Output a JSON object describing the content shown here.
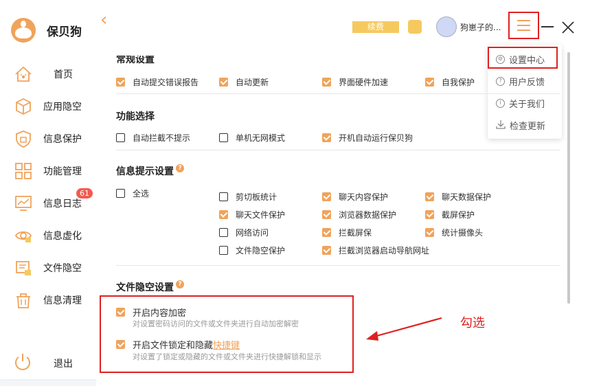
{
  "app": {
    "name": "保贝狗"
  },
  "sidebar": {
    "items": [
      {
        "label": "首页",
        "icon": "home-paw-icon"
      },
      {
        "label": "应用隐空",
        "icon": "cube-icon"
      },
      {
        "label": "信息保护",
        "icon": "shield-bag-icon"
      },
      {
        "label": "功能管理",
        "icon": "grid-icon"
      },
      {
        "label": "信息日志",
        "icon": "chart-monitor-icon",
        "badge": "61"
      },
      {
        "label": "信息虚化",
        "icon": "eye-lock-icon"
      },
      {
        "label": "文件隐空",
        "icon": "folder-lock-icon"
      },
      {
        "label": "信息清理",
        "icon": "trash-icon"
      }
    ],
    "logout": "退出"
  },
  "header": {
    "renew": "续费",
    "username": "狗崽子的...",
    "menu": [
      "设置中心",
      "用户反馈",
      "关于我们",
      "检查更新"
    ]
  },
  "settings": {
    "general": {
      "title": "常规设置",
      "options": [
        {
          "label": "自动提交错误报告",
          "checked": true
        },
        {
          "label": "自动更新",
          "checked": true
        },
        {
          "label": "界面硬件加速",
          "checked": true
        },
        {
          "label": "自我保护",
          "checked": true
        }
      ]
    },
    "features": {
      "title": "功能选择",
      "options": [
        {
          "label": "自动拦截不提示",
          "checked": false
        },
        {
          "label": "单机无网模式",
          "checked": false
        },
        {
          "label": "开机自动运行保贝狗",
          "checked": true
        }
      ]
    },
    "notify": {
      "title": "信息提示设置",
      "select_all": "全选",
      "options": [
        {
          "label": "剪切板统计",
          "checked": false
        },
        {
          "label": "聊天内容保护",
          "checked": true
        },
        {
          "label": "聊天数据保护",
          "checked": true
        },
        {
          "label": "聊天文件保护",
          "checked": true
        },
        {
          "label": "浏览器数据保护",
          "checked": true
        },
        {
          "label": "截屏保护",
          "checked": true
        },
        {
          "label": "网络访问",
          "checked": false
        },
        {
          "label": "拦截屏保",
          "checked": true
        },
        {
          "label": "统计摄像头",
          "checked": true
        },
        {
          "label": "文件隐空保护",
          "checked": false
        },
        {
          "label": "拦截浏览器启动导航网址",
          "checked": true
        }
      ]
    },
    "file_space": {
      "title": "文件隐空设置",
      "encrypt_label": "开启内容加密",
      "encrypt_desc": "对设置密码访问的文件或文件夹进行自动加密解密",
      "lock_label": "开启文件锁定和隐藏",
      "lock_link": "快捷键",
      "lock_desc": "对设置了锁定或隐藏的文件或文件夹进行快捷解锁和显示"
    }
  },
  "annotation": "勾选",
  "colors": {
    "accent": "#f0a35b",
    "highlight": "#e02020"
  }
}
